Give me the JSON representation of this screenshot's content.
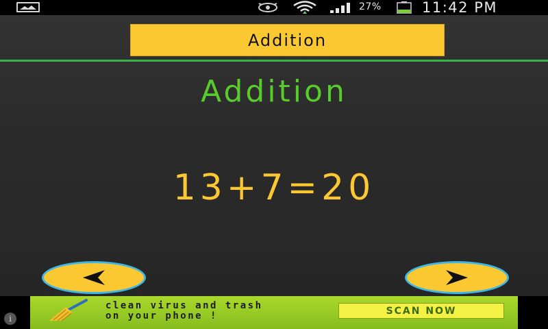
{
  "status_bar": {
    "battery": "27%",
    "time": "11:42 PM"
  },
  "header": {
    "button_label": "Addition"
  },
  "main": {
    "title": "Addition",
    "equation": "13+7=20"
  },
  "nav": {
    "prev_icon": "arrow-left-icon",
    "next_icon": "arrow-right-icon"
  },
  "ad": {
    "line1": "clean virus and trash",
    "line2": "on your phone !",
    "cta": "SCAN NOW"
  },
  "colors": {
    "accent_yellow": "#fcc832",
    "title_green": "#57cc2c",
    "divider_green": "#39b449",
    "nav_ring_blue": "#3fb7e6"
  }
}
